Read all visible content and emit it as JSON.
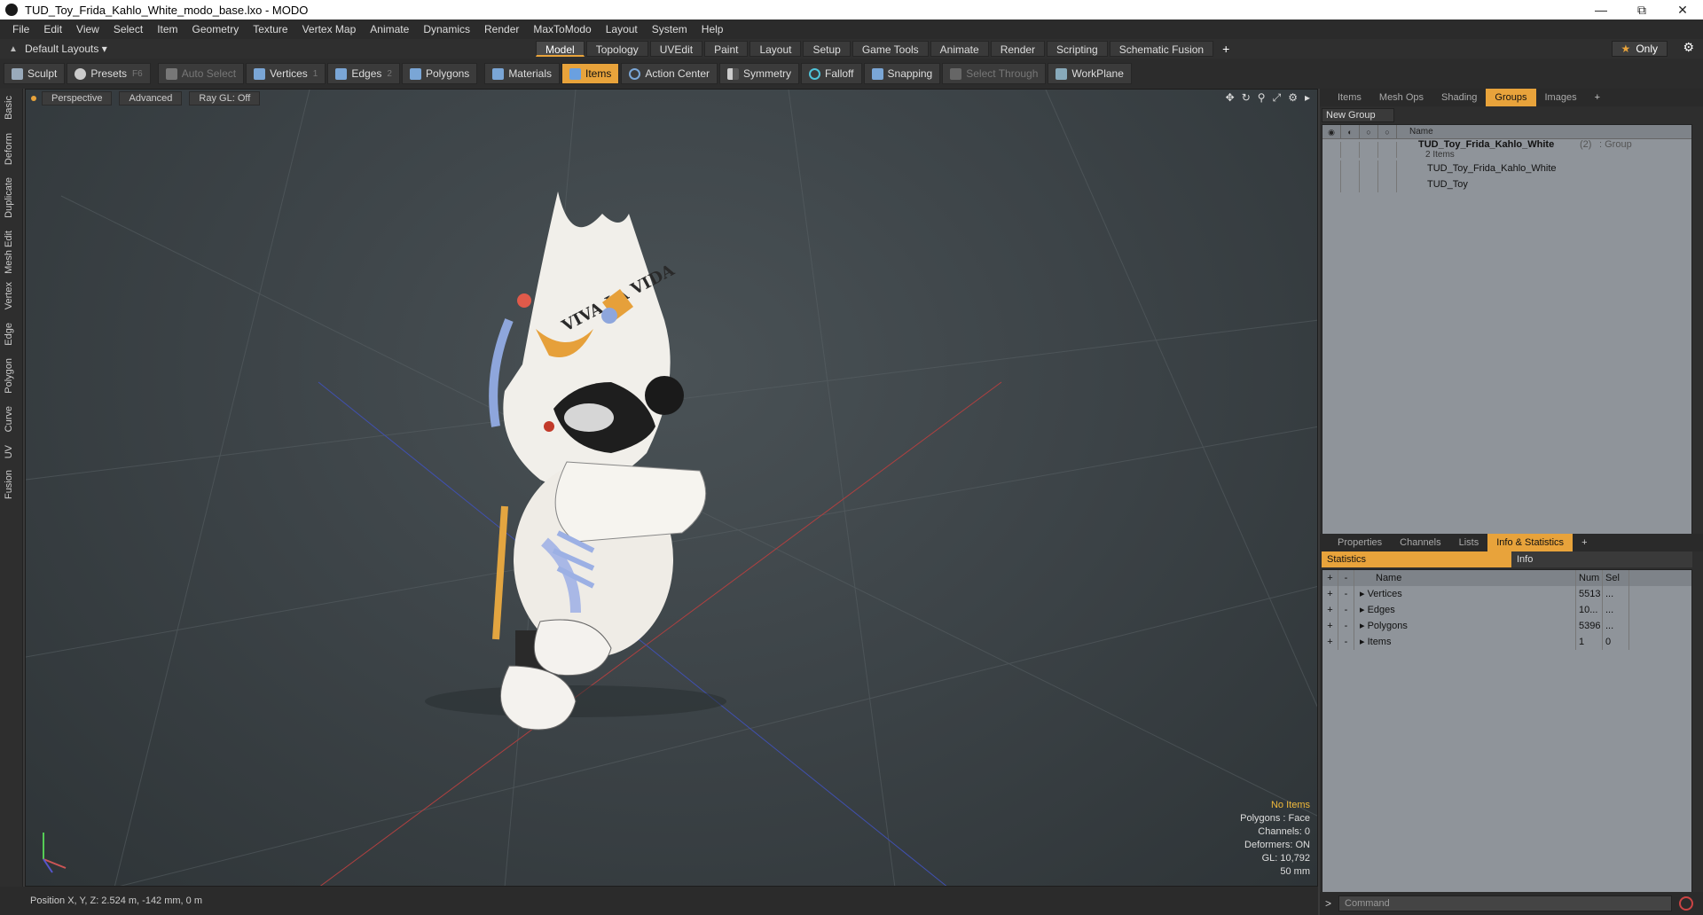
{
  "window": {
    "title": "TUD_Toy_Frida_Kahlo_White_modo_base.lxo - MODO",
    "minimize": "—",
    "maximize": "⧉",
    "close": "✕"
  },
  "menu": [
    "File",
    "Edit",
    "View",
    "Select",
    "Item",
    "Geometry",
    "Texture",
    "Vertex Map",
    "Animate",
    "Dynamics",
    "Render",
    "MaxToModo",
    "Layout",
    "System",
    "Help"
  ],
  "layoutbar": {
    "layout_label": "Default Layouts ▾",
    "tabs": [
      "Model",
      "Topology",
      "UVEdit",
      "Paint",
      "Layout",
      "Setup",
      "Game Tools",
      "Animate",
      "Render",
      "Scripting",
      "Schematic Fusion"
    ],
    "active_tab": "Model",
    "plus": "+",
    "only": "Only"
  },
  "toolbar": {
    "sculpt": "Sculpt",
    "presets": "Presets",
    "presets_key": "F6",
    "auto_select": "Auto Select",
    "vertices": "Vertices",
    "vertices_key": "1",
    "edges": "Edges",
    "edges_key": "2",
    "polygons": "Polygons",
    "materials": "Materials",
    "items": "Items",
    "action_center": "Action Center",
    "symmetry": "Symmetry",
    "falloff": "Falloff",
    "snapping": "Snapping",
    "select_through": "Select Through",
    "workplane": "WorkPlane"
  },
  "left_tabs": [
    "Basic",
    "Deform",
    "Duplicate",
    "Mesh Edit",
    "Vertex",
    "Edge",
    "Polygon",
    "Curve",
    "UV",
    "Fusion"
  ],
  "viewport": {
    "view": "Perspective",
    "advanced": "Advanced",
    "raygl": "Ray GL: Off",
    "stats": {
      "items": "No Items",
      "polygons": "Polygons : Face",
      "channels": "Channels: 0",
      "deformers": "Deformers: ON",
      "gl": "GL: 10,792",
      "size": "50 mm"
    },
    "artwork_text": "VIVA LA VIDA"
  },
  "status": {
    "position": "Position X, Y, Z:   2.524 m, -142 mm, 0 m"
  },
  "right_top": {
    "tabs": [
      "Items",
      "Mesh Ops",
      "Shading",
      "Groups",
      "Images"
    ],
    "active_tab": "Groups",
    "new_group": "New Group",
    "name_header": "Name",
    "group_name": "TUD_Toy_Frida_Kahlo_White",
    "group_count": "(2)",
    "group_type": ": Group",
    "group_items": "2 Items",
    "children": [
      "TUD_Toy_Frida_Kahlo_White",
      "TUD_Toy"
    ]
  },
  "right_bottom": {
    "tabs": [
      "Properties",
      "Channels",
      "Lists",
      "Info & Statistics"
    ],
    "active_tab": "Info & Statistics",
    "stat_tab": "Statistics",
    "info_tab": "Info",
    "headers": {
      "name": "Name",
      "num": "Num",
      "sel": "Sel"
    },
    "rows": [
      {
        "name": "Vertices",
        "num": "5513",
        "sel": "..."
      },
      {
        "name": "Edges",
        "num": "10...",
        "sel": "..."
      },
      {
        "name": "Polygons",
        "num": "5396",
        "sel": "..."
      },
      {
        "name": "Items",
        "num": "1",
        "sel": "0"
      }
    ]
  },
  "command": {
    "prompt": ">",
    "placeholder": "Command"
  }
}
